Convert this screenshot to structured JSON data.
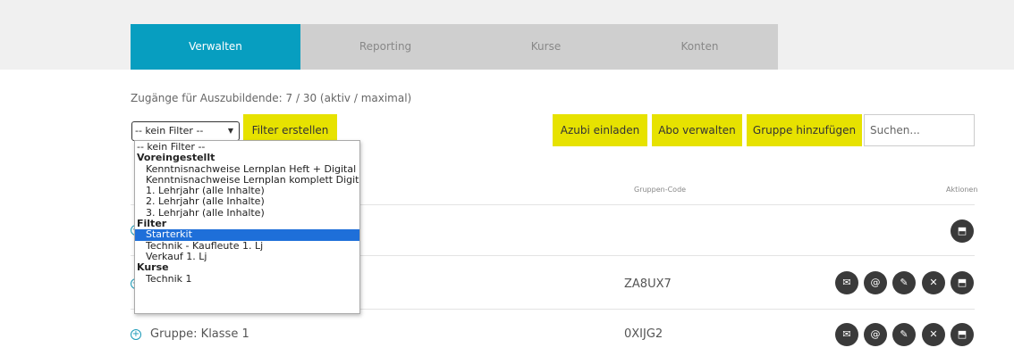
{
  "nav": {
    "tabs": [
      {
        "label": "Verwalten",
        "active": true
      },
      {
        "label": "Reporting",
        "active": false
      },
      {
        "label": "Kurse",
        "active": false
      },
      {
        "label": "Konten",
        "active": false
      }
    ]
  },
  "info_text": "Zugänge für Auszubildende: 7 / 30 (aktiv / maximal)",
  "filter": {
    "selected": "-- kein Filter --",
    "create_label": "Filter erstellen",
    "options": [
      {
        "label": "-- kein Filter --",
        "kind": "option"
      },
      {
        "label": "Voreingestellt",
        "kind": "group"
      },
      {
        "label": "Kenntnisnachweise Lernplan Heft + Digital",
        "kind": "sub"
      },
      {
        "label": "Kenntnisnachweise Lernplan komplett Digital",
        "kind": "sub"
      },
      {
        "label": "1. Lehrjahr (alle Inhalte)",
        "kind": "sub"
      },
      {
        "label": "2. Lehrjahr (alle Inhalte)",
        "kind": "sub"
      },
      {
        "label": "3. Lehrjahr (alle Inhalte)",
        "kind": "sub"
      },
      {
        "label": "Filter",
        "kind": "group"
      },
      {
        "label": "Starterkit",
        "kind": "sub",
        "highlighted": true
      },
      {
        "label": "Technik - Kaufleute 1. Lj",
        "kind": "sub"
      },
      {
        "label": "Verkauf 1. Lj",
        "kind": "sub"
      },
      {
        "label": "Kurse",
        "kind": "group"
      },
      {
        "label": "Technik 1",
        "kind": "sub"
      }
    ]
  },
  "actions": {
    "invite": "Azubi einladen",
    "subscription": "Abo verwalten",
    "add_group": "Gruppe hinzufügen",
    "search_placeholder": "Suchen..."
  },
  "table": {
    "col_code": "Gruppen-Code",
    "col_actions": "Aktionen",
    "rows": [
      {
        "label": "",
        "code": ""
      },
      {
        "label": "",
        "code": "ZA8UX7"
      },
      {
        "label": "Gruppe: Klasse 1",
        "code": "0XIJG2"
      }
    ]
  },
  "colors": {
    "accent": "#079ec0",
    "button_yellow": "#e7e200",
    "icon_dark": "#3a3a3a",
    "selected": "#1e6fd9"
  }
}
